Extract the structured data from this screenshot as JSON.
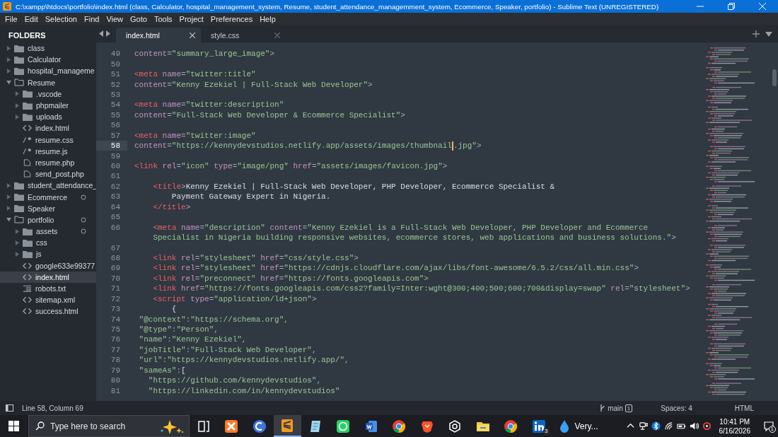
{
  "window": {
    "title": "C:\\xampp\\htdocs\\portfolio\\index.html (class, Calculator, hospital_management_system, Resume, student_attendance_managemment_system, Ecommerce, Speaker, portfolio) - Sublime Text (UNREGISTERED)"
  },
  "menu": [
    "File",
    "Edit",
    "Selection",
    "Find",
    "View",
    "Goto",
    "Tools",
    "Project",
    "Preferences",
    "Help"
  ],
  "sidebar": {
    "title": "FOLDERS",
    "items": [
      {
        "label": "class",
        "kind": "folder",
        "expanded": false,
        "selected": false,
        "marked": false
      },
      {
        "label": "Calculator",
        "kind": "folder",
        "expanded": false,
        "selected": false,
        "marked": false
      },
      {
        "label": "hospital_manageme",
        "kind": "folder",
        "expanded": false,
        "selected": false,
        "marked": false
      },
      {
        "label": "Resume",
        "kind": "folder",
        "expanded": true,
        "selected": false,
        "marked": false,
        "children": [
          {
            "label": ".vscode",
            "kind": "folder",
            "expanded": false,
            "selected": false,
            "marked": false
          },
          {
            "label": "phpmailer",
            "kind": "folder",
            "expanded": false,
            "selected": false,
            "marked": false
          },
          {
            "label": "uploads",
            "kind": "folder",
            "expanded": false,
            "selected": false,
            "marked": false
          },
          {
            "label": "index.html",
            "kind": "markup",
            "selected": false,
            "marked": false
          },
          {
            "label": "resume.css",
            "kind": "script",
            "selected": false,
            "marked": false
          },
          {
            "label": "resume.js",
            "kind": "script",
            "selected": false,
            "marked": false
          },
          {
            "label": "resume.php",
            "kind": "document",
            "selected": false,
            "marked": false
          },
          {
            "label": "send_post.php",
            "kind": "document",
            "selected": false,
            "marked": false
          }
        ]
      },
      {
        "label": "student_attendance_",
        "kind": "folder",
        "expanded": false,
        "selected": false,
        "marked": false
      },
      {
        "label": "Ecommerce",
        "kind": "folder",
        "expanded": false,
        "selected": false,
        "marked": true
      },
      {
        "label": "Speaker",
        "kind": "folder",
        "expanded": false,
        "selected": false,
        "marked": false
      },
      {
        "label": "portfolio",
        "kind": "folder",
        "expanded": true,
        "selected": false,
        "marked": true,
        "children": [
          {
            "label": "assets",
            "kind": "folder",
            "expanded": false,
            "selected": false,
            "marked": true
          },
          {
            "label": "css",
            "kind": "folder",
            "expanded": false,
            "selected": false,
            "marked": false
          },
          {
            "label": "js",
            "kind": "folder",
            "expanded": false,
            "selected": false,
            "marked": false
          },
          {
            "label": "google633e99377",
            "kind": "markup",
            "selected": false,
            "marked": false
          },
          {
            "label": "index.html",
            "kind": "markup",
            "selected": true,
            "marked": false
          },
          {
            "label": "robots.txt",
            "kind": "text",
            "selected": false,
            "marked": false
          },
          {
            "label": "sitemap.xml",
            "kind": "markup",
            "selected": false,
            "marked": false
          },
          {
            "label": "success.html",
            "kind": "markup",
            "selected": false,
            "marked": false
          }
        ]
      }
    ]
  },
  "tabs": [
    {
      "label": "index.html",
      "selected": true
    },
    {
      "label": "style.css",
      "selected": false
    }
  ],
  "editor": {
    "lines": [
      {
        "number": "49",
        "current": false,
        "tokens": [
          {
            "kind": "attr",
            "text": "content"
          },
          {
            "kind": "punct",
            "text": "="
          },
          {
            "kind": "string",
            "text": "\"summary_large_image\""
          },
          {
            "kind": "punct",
            "text": ">"
          }
        ]
      },
      {
        "number": "50",
        "current": false
      },
      {
        "number": "51",
        "current": false,
        "tokens": [
          {
            "kind": "tag",
            "text": "<meta"
          },
          {
            "kind": "attr",
            "text": " name"
          },
          {
            "kind": "punct",
            "text": "="
          },
          {
            "kind": "string",
            "text": "\"twitter:title\""
          }
        ]
      },
      {
        "number": "52",
        "current": false,
        "tokens": [
          {
            "kind": "attr",
            "text": "content"
          },
          {
            "kind": "punct",
            "text": "="
          },
          {
            "kind": "string",
            "text": "\"Kenny Ezekiel | Full-Stack Web Developer\""
          },
          {
            "kind": "punct",
            "text": ">"
          }
        ]
      },
      {
        "number": "53",
        "current": false
      },
      {
        "number": "54",
        "current": false,
        "tokens": [
          {
            "kind": "tag",
            "text": "<meta"
          },
          {
            "kind": "attr",
            "text": " name"
          },
          {
            "kind": "punct",
            "text": "="
          },
          {
            "kind": "string",
            "text": "\"twitter:description\""
          }
        ]
      },
      {
        "number": "55",
        "current": false,
        "tokens": [
          {
            "kind": "attr",
            "text": "content"
          },
          {
            "kind": "punct",
            "text": "="
          },
          {
            "kind": "string",
            "text": "\"Full-Stack Web Developer & Ecommerce Specialist\""
          },
          {
            "kind": "punct",
            "text": ">"
          }
        ]
      },
      {
        "number": "56",
        "current": false
      },
      {
        "number": "57",
        "current": false,
        "tokens": [
          {
            "kind": "tag",
            "text": "<meta"
          },
          {
            "kind": "attr",
            "text": " name"
          },
          {
            "kind": "punct",
            "text": "="
          },
          {
            "kind": "string",
            "text": "\"twitter:image\""
          }
        ]
      },
      {
        "number": "58",
        "current": true,
        "tokens": [
          {
            "kind": "attr",
            "text": "content"
          },
          {
            "kind": "punct",
            "text": "="
          },
          {
            "kind": "string",
            "text": "\"https://kennydevstudios.netlify.app/assets/images/thumbnail"
          },
          {
            "kind": "caret"
          },
          {
            "kind": "string",
            "text": ".jpg\""
          },
          {
            "kind": "punct",
            "text": ">"
          }
        ]
      },
      {
        "number": "59",
        "current": false
      },
      {
        "number": "60",
        "current": false,
        "tokens": [
          {
            "kind": "tag",
            "text": "<link"
          },
          {
            "kind": "attr",
            "text": " rel"
          },
          {
            "kind": "punct",
            "text": "="
          },
          {
            "kind": "string",
            "text": "\"icon\""
          },
          {
            "kind": "attr",
            "text": " type"
          },
          {
            "kind": "punct",
            "text": "="
          },
          {
            "kind": "string",
            "text": "\"image/png\""
          },
          {
            "kind": "attr",
            "text": " href"
          },
          {
            "kind": "punct",
            "text": "="
          },
          {
            "kind": "string",
            "text": "\"assets/images/favicon.jpg\""
          },
          {
            "kind": "punct",
            "text": ">"
          }
        ]
      },
      {
        "number": "61",
        "current": false
      },
      {
        "number": "62",
        "current": false,
        "tokens": [
          {
            "kind": "tag",
            "text": "    <title"
          },
          {
            "kind": "punct",
            "text": ">"
          },
          {
            "kind": "text",
            "text": "Kenny Ezekiel | Full-Stack Web Developer, PHP Developer, Ecommerce Specialist &"
          }
        ]
      },
      {
        "number": "63",
        "current": false,
        "tokens": [
          {
            "kind": "text",
            "text": "        Payment Gateway Expert in Nigeria."
          }
        ]
      },
      {
        "number": "64",
        "current": false,
        "tokens": [
          {
            "kind": "tag",
            "text": "    </title"
          },
          {
            "kind": "punct",
            "text": ">"
          }
        ]
      },
      {
        "number": "65",
        "current": false
      },
      {
        "number": "66",
        "current": false,
        "tokens": [
          {
            "kind": "tag",
            "text": "    <meta"
          },
          {
            "kind": "attr",
            "text": " name"
          },
          {
            "kind": "punct",
            "text": "="
          },
          {
            "kind": "string",
            "text": "\"description\""
          },
          {
            "kind": "attr",
            "text": " content"
          },
          {
            "kind": "punct",
            "text": "="
          },
          {
            "kind": "string",
            "text": "\"Kenny Ezekiel is a Full-Stack Web Developer, PHP Developer and Ecommerce"
          }
        ]
      },
      {
        "tokens": [
          {
            "kind": "string",
            "text": "    Specialist in Nigeria building responsive websites, ecommerce stores, web applications and business solutions.\""
          },
          {
            "kind": "punct",
            "text": ">"
          }
        ]
      },
      {
        "number": "67",
        "current": false
      },
      {
        "number": "68",
        "current": false,
        "tokens": [
          {
            "kind": "tag",
            "text": "    <link"
          },
          {
            "kind": "attr",
            "text": " rel"
          },
          {
            "kind": "punct",
            "text": "="
          },
          {
            "kind": "string",
            "text": "\"stylesheet\""
          },
          {
            "kind": "attr",
            "text": " href"
          },
          {
            "kind": "punct",
            "text": "="
          },
          {
            "kind": "string",
            "text": "\"css/style.css\""
          },
          {
            "kind": "punct",
            "text": ">"
          }
        ]
      },
      {
        "number": "69",
        "current": false,
        "tokens": [
          {
            "kind": "tag",
            "text": "    <link"
          },
          {
            "kind": "attr",
            "text": " rel"
          },
          {
            "kind": "punct",
            "text": "="
          },
          {
            "kind": "string",
            "text": "\"stylesheet\""
          },
          {
            "kind": "attr",
            "text": " href"
          },
          {
            "kind": "punct",
            "text": "="
          },
          {
            "kind": "string",
            "text": "\"https://cdnjs.cloudflare.com/ajax/libs/font-awesome/6.5.2/css/all.min.css\""
          },
          {
            "kind": "punct",
            "text": ">"
          }
        ]
      },
      {
        "number": "70",
        "current": false,
        "tokens": [
          {
            "kind": "tag",
            "text": "    <link"
          },
          {
            "kind": "attr",
            "text": " rel"
          },
          {
            "kind": "punct",
            "text": "="
          },
          {
            "kind": "string",
            "text": "\"preconnect\""
          },
          {
            "kind": "attr",
            "text": " href"
          },
          {
            "kind": "punct",
            "text": "="
          },
          {
            "kind": "string",
            "text": "\"https://fonts.googleapis.com\""
          },
          {
            "kind": "punct",
            "text": ">"
          }
        ]
      },
      {
        "number": "71",
        "current": false,
        "tokens": [
          {
            "kind": "tag",
            "text": "    <link"
          },
          {
            "kind": "attr",
            "text": " href"
          },
          {
            "kind": "punct",
            "text": "="
          },
          {
            "kind": "string",
            "text": "\"https://fonts.googleapis.com/css2?family=Inter:wght@300;400;500;600;700&display=swap\""
          },
          {
            "kind": "attr",
            "text": " rel"
          },
          {
            "kind": "punct",
            "text": "="
          },
          {
            "kind": "string",
            "text": "\"stylesheet\""
          },
          {
            "kind": "punct",
            "text": ">"
          }
        ]
      },
      {
        "number": "72",
        "current": false,
        "tokens": [
          {
            "kind": "tag",
            "text": "    <script"
          },
          {
            "kind": "attr",
            "text": " type"
          },
          {
            "kind": "punct",
            "text": "="
          },
          {
            "kind": "string",
            "text": "\"application/ld+json\""
          },
          {
            "kind": "punct",
            "text": ">"
          }
        ]
      },
      {
        "number": "73",
        "current": false,
        "tokens": [
          {
            "kind": "text",
            "text": "        {"
          }
        ]
      },
      {
        "number": "74",
        "current": false,
        "tokens": [
          {
            "kind": "string",
            "text": " \"@context\""
          },
          {
            "kind": "punct",
            "text": ":"
          },
          {
            "kind": "string",
            "text": "\"https://schema.org\""
          },
          {
            "kind": "punct",
            "text": ","
          }
        ]
      },
      {
        "number": "75",
        "current": false,
        "tokens": [
          {
            "kind": "string",
            "text": " \"@type\""
          },
          {
            "kind": "punct",
            "text": ":"
          },
          {
            "kind": "string",
            "text": "\"Person\""
          },
          {
            "kind": "punct",
            "text": ","
          }
        ]
      },
      {
        "number": "76",
        "current": false,
        "tokens": [
          {
            "kind": "string",
            "text": " \"name\""
          },
          {
            "kind": "punct",
            "text": ":"
          },
          {
            "kind": "string",
            "text": "\"Kenny Ezekiel\""
          },
          {
            "kind": "punct",
            "text": ","
          }
        ]
      },
      {
        "number": "77",
        "current": false,
        "tokens": [
          {
            "kind": "string",
            "text": " \"jobTitle\""
          },
          {
            "kind": "punct",
            "text": ":"
          },
          {
            "kind": "string",
            "text": "\"Full-Stack Web Developer\""
          },
          {
            "kind": "punct",
            "text": ","
          }
        ]
      },
      {
        "number": "78",
        "current": false,
        "tokens": [
          {
            "kind": "string",
            "text": " \"url\""
          },
          {
            "kind": "punct",
            "text": ":"
          },
          {
            "kind": "string",
            "text": "\"https://kennydevstudios.netlify.app/\""
          },
          {
            "kind": "punct",
            "text": ","
          }
        ]
      },
      {
        "number": "79",
        "current": false,
        "tokens": [
          {
            "kind": "string",
            "text": " \"sameAs\""
          },
          {
            "kind": "punct",
            "text": ":"
          },
          {
            "kind": "text",
            "text": "["
          }
        ]
      },
      {
        "number": "80",
        "current": false,
        "tokens": [
          {
            "kind": "string",
            "text": "   \"https://github.com/kennydevstudios\""
          },
          {
            "kind": "punct",
            "text": ","
          }
        ]
      },
      {
        "number": "81",
        "current": false,
        "tokens": [
          {
            "kind": "string",
            "text": "   \"https://linkedin.com/in/kennydevstudios\""
          }
        ]
      }
    ]
  },
  "status_bar": {
    "position": "Line 58, Column 69",
    "branch": "main",
    "branch_count": "1",
    "indentation": "Spaces: 4",
    "syntax": "HTML"
  },
  "taskbar": {
    "search": {
      "placeholder": "Type here to search"
    },
    "apps": [
      {
        "kind": "taskview",
        "active": false
      },
      {
        "kind": "xampp",
        "active": false
      },
      {
        "kind": "canva",
        "active": false
      },
      {
        "kind": "sublime",
        "active": true
      },
      {
        "kind": "notepad",
        "active": false
      },
      {
        "kind": "whatsapp",
        "active": false
      },
      {
        "kind": "word",
        "active": false
      },
      {
        "kind": "chrome",
        "active": false
      },
      {
        "kind": "brave",
        "active": false
      },
      {
        "kind": "chatgpt",
        "active": false
      },
      {
        "kind": "explorer",
        "active": false
      },
      {
        "kind": "chrome",
        "active": false
      },
      {
        "kind": "linkedin",
        "active": false,
        "badge": "3"
      },
      {
        "kind": "weather",
        "active": false,
        "label": "Very..."
      }
    ],
    "tray": [
      {
        "kind": "chevron"
      },
      {
        "kind": "camera"
      },
      {
        "kind": "bluetooth"
      },
      {
        "kind": "wifi"
      },
      {
        "kind": "battery"
      },
      {
        "kind": "volume"
      },
      {
        "kind": "alert"
      }
    ],
    "time": "10:41 PM",
    "date": "6/16/2026",
    "notifications": "1"
  }
}
